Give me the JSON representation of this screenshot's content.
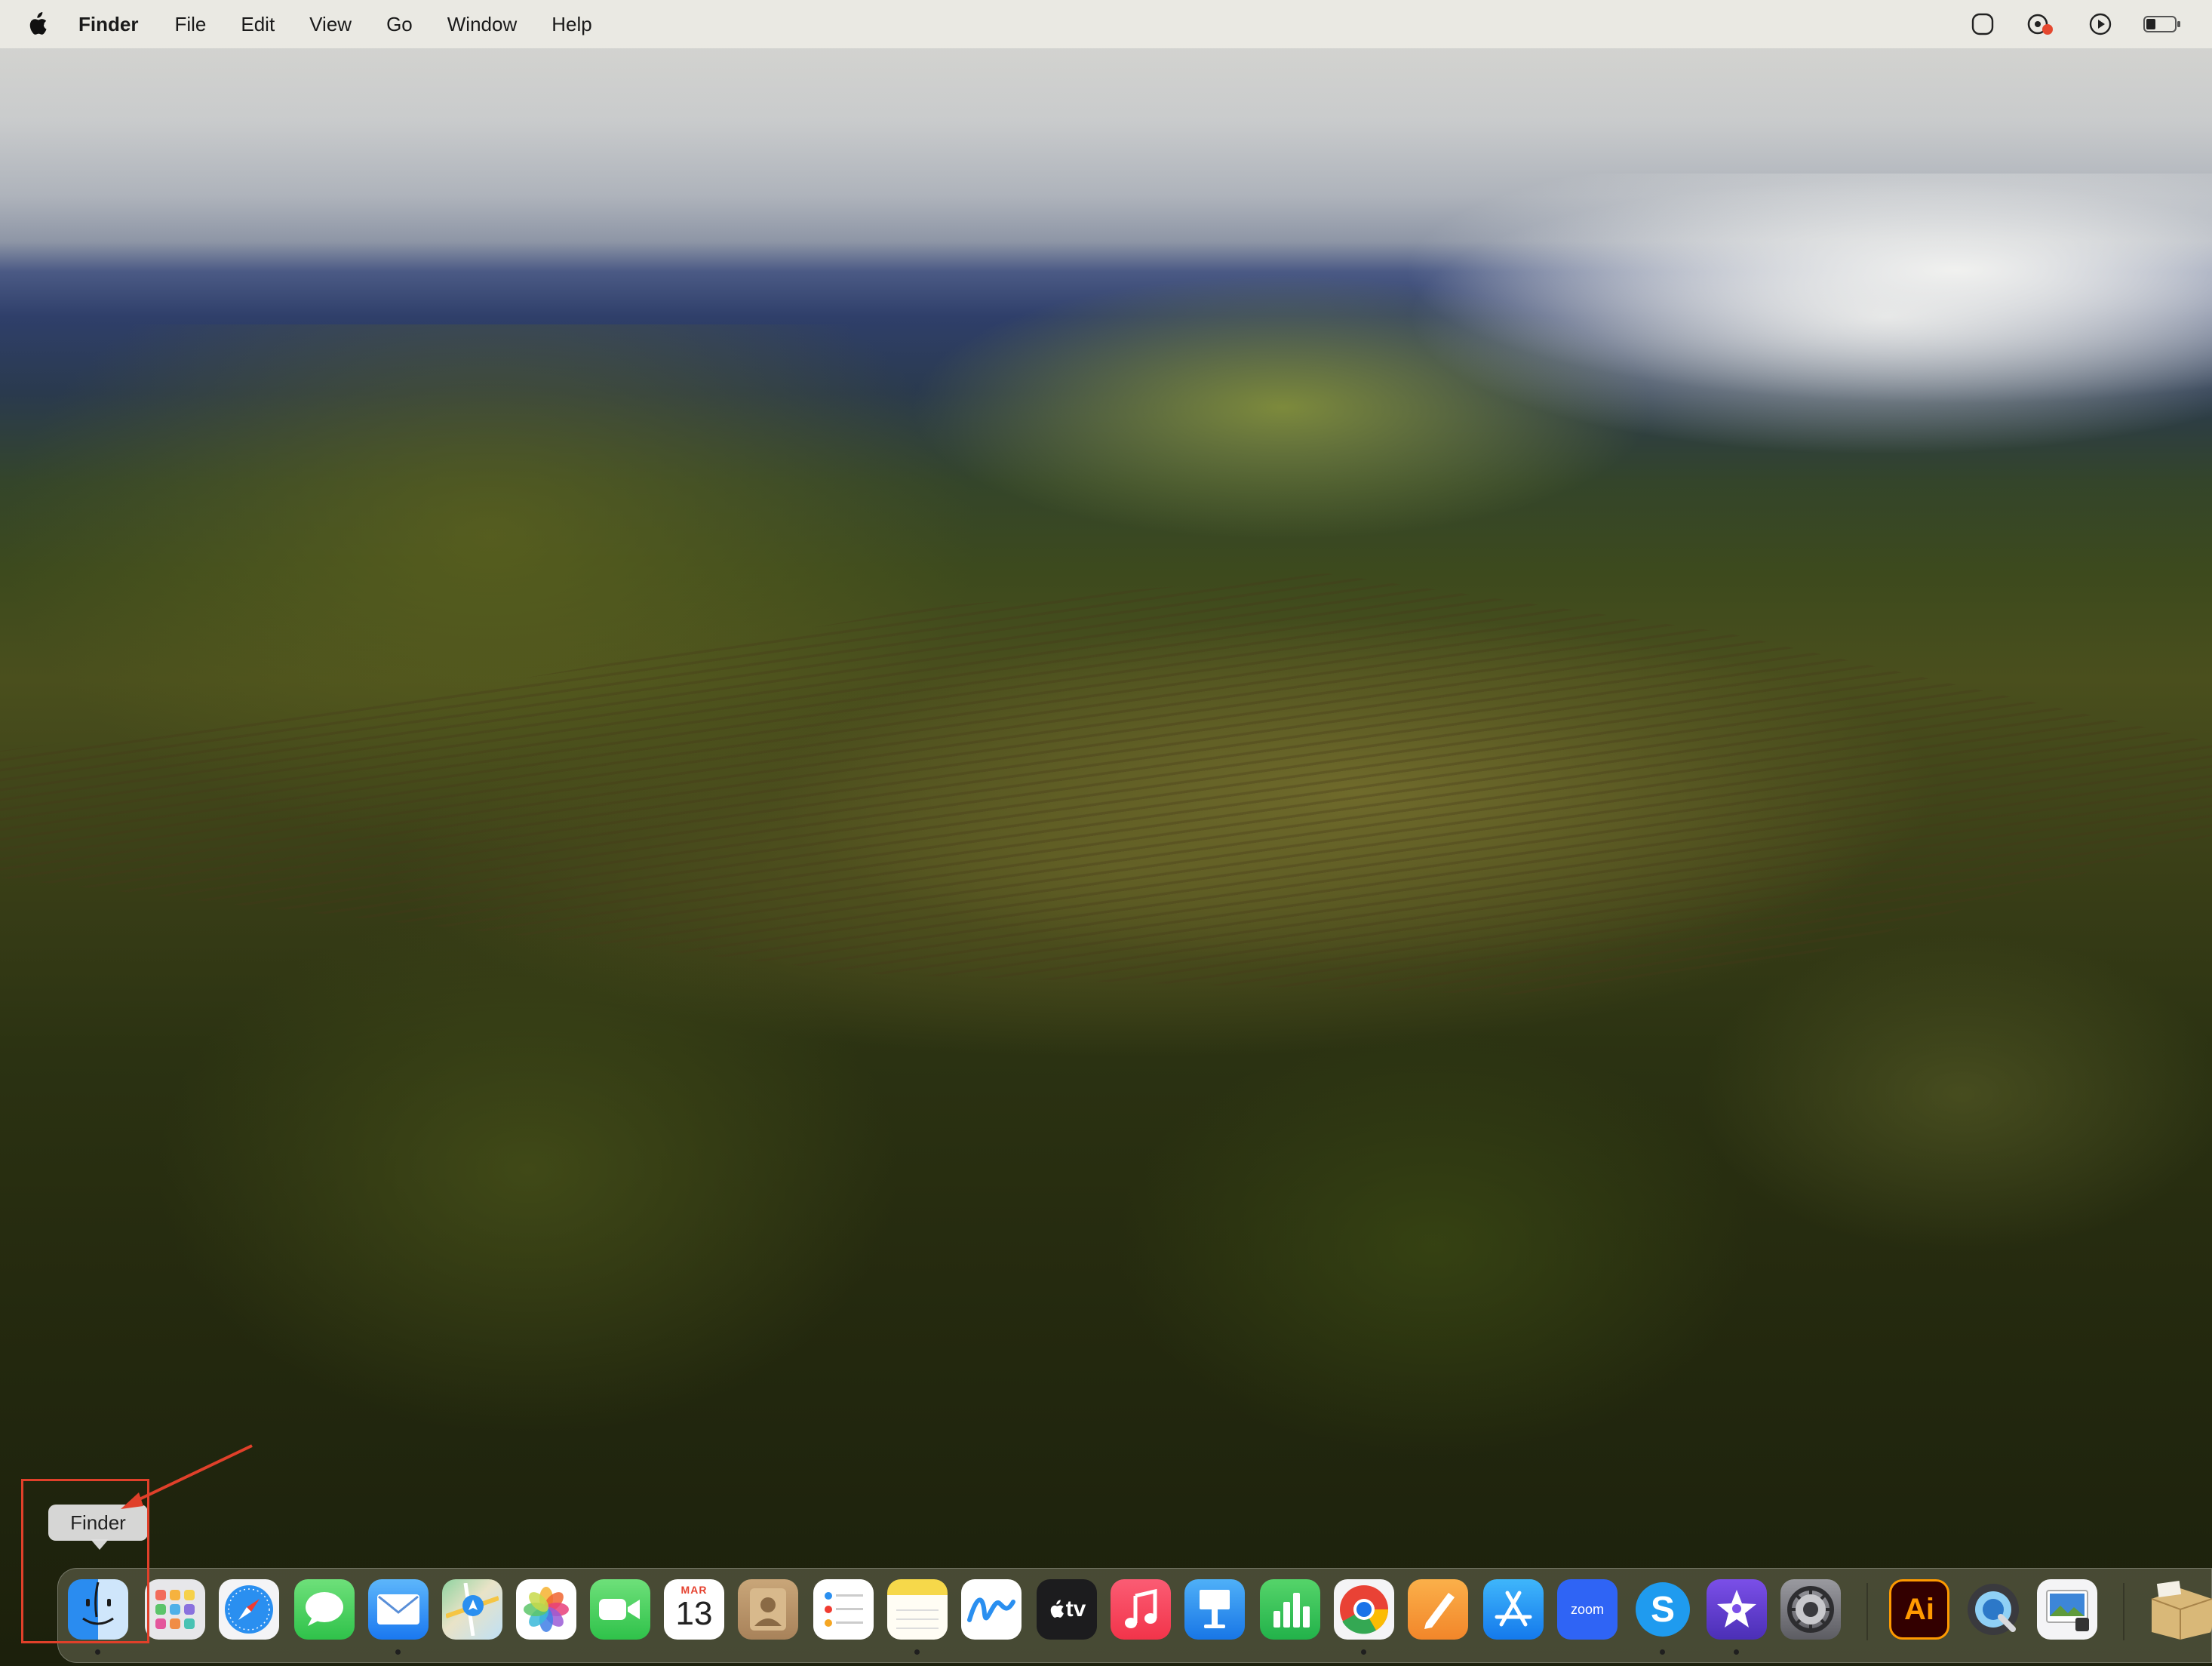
{
  "menubar": {
    "apple_icon": "apple-logo-icon",
    "app_name": "Finder",
    "items": [
      "File",
      "Edit",
      "View",
      "Go",
      "Window",
      "Help"
    ],
    "status_icons": [
      "screen-mirror-icon",
      "focus-icon",
      "play-icon",
      "battery-icon"
    ]
  },
  "tooltip": {
    "label": "Finder"
  },
  "dock": {
    "calendar": {
      "month": "MAR",
      "day": "13"
    },
    "appletv_label": "tv",
    "zoom_label": "zoom",
    "skype_label": "S",
    "illustrator_label": "Ai"
  },
  "colors": {
    "annotation": "#e0402a",
    "menubar_bg": "#eceae4"
  }
}
